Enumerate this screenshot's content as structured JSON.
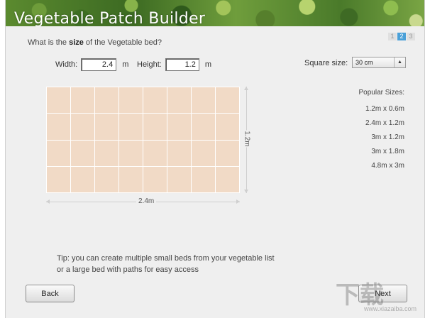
{
  "header": {
    "title": "Vegetable Patch Builder"
  },
  "steps": [
    "1",
    "2",
    "3"
  ],
  "question": {
    "prefix": "What is the ",
    "bold": "size",
    "suffix": " of the Vegetable bed?"
  },
  "dimensions": {
    "width_label": "Width:",
    "width_value": "2.4",
    "width_unit": "m",
    "height_label": "Height:",
    "height_value": "1.2",
    "height_unit": "m"
  },
  "square_size": {
    "label": "Square size:",
    "selected": "30 cm"
  },
  "bed": {
    "columns": 8,
    "rows": 4,
    "cell_color": "#f1dac6"
  },
  "measure": {
    "width_label": "2.4m",
    "height_label": "1.2m"
  },
  "popular_sizes": {
    "title": "Popular Sizes:",
    "items": [
      "1.2m x 0.6m",
      "2.4m x 1.2m",
      "3m x 1.2m",
      "3m x 1.8m",
      "4.8m x 3m"
    ]
  },
  "tip": {
    "line1": "Tip: you can create multiple small beds from your vegetable list",
    "line2": "or a large bed with paths for easy access"
  },
  "buttons": {
    "back": "Back",
    "next": "Next"
  },
  "watermark": {
    "text": "下载",
    "sub": "www.xiazaiba.com"
  }
}
